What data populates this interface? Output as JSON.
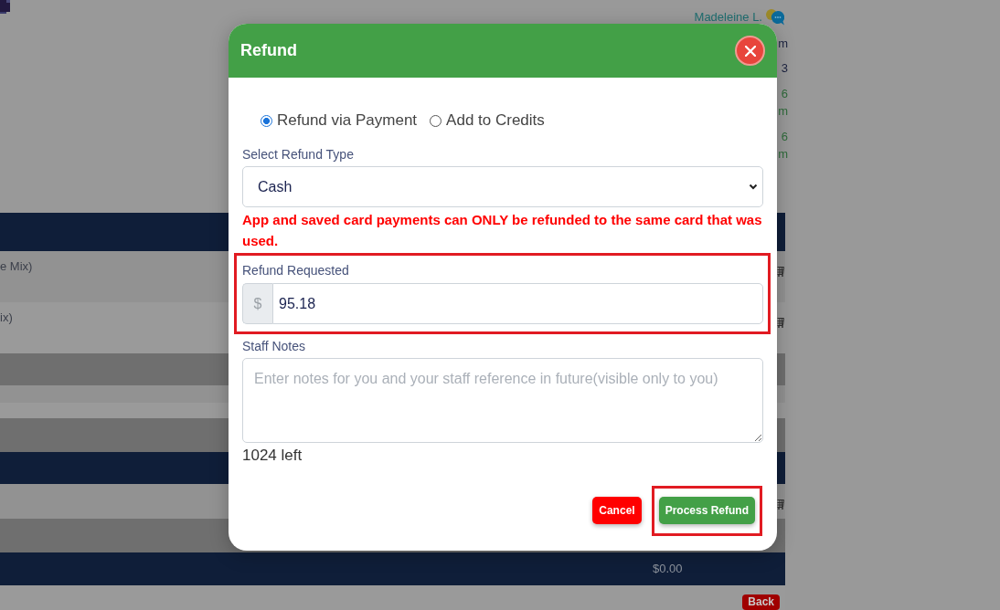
{
  "background": {
    "user_name": "Madeleine L.",
    "side_texts": [
      {
        "text": "m",
        "color": "#1c2340"
      },
      {
        "text": "3",
        "color": "#1c2340"
      },
      {
        "text": "6",
        "color": "#2f6b3b"
      },
      {
        "text": "m",
        "color": "#2f6b3b"
      },
      {
        "text": "6",
        "color": "#2f6b3b"
      },
      {
        "text": "m",
        "color": "#2f6b3b"
      }
    ],
    "bands": [
      {
        "kind": "header"
      },
      {
        "kind": "light",
        "text": "e Mix)",
        "cart": true
      },
      {
        "kind": "pale",
        "text": "ix)",
        "cart": true
      },
      {
        "kind": "dark"
      },
      {
        "kind": "light"
      },
      {
        "kind": "pale"
      },
      {
        "kind": "dark"
      },
      {
        "kind": "header"
      },
      {
        "kind": "light",
        "cart": true
      },
      {
        "kind": "dark"
      },
      {
        "kind": "header",
        "text": "$0.00"
      },
      {
        "kind": "pale",
        "button": "Back"
      }
    ]
  },
  "dialog": {
    "title": "Refund",
    "options": [
      {
        "label": "Refund via Payment",
        "selected": true
      },
      {
        "label": "Add to Credits",
        "selected": false
      }
    ],
    "refund_type": {
      "label": "Select Refund Type",
      "value": "Cash"
    },
    "warning": "App and saved card payments can ONLY be refunded to the same card that was used.",
    "refund_requested": {
      "label": "Refund Requested",
      "prefix": "$",
      "value": "95.18",
      "highlighted": true
    },
    "staff_notes": {
      "label": "Staff Notes",
      "placeholder": "Enter notes for you and your staff reference in future(visible only to you)",
      "remaining": "1024 left"
    },
    "buttons": [
      {
        "label": "Cancel",
        "kind": "cancel",
        "highlighted": false
      },
      {
        "label": "Process Refund",
        "kind": "confirm",
        "highlighted": true
      }
    ]
  }
}
